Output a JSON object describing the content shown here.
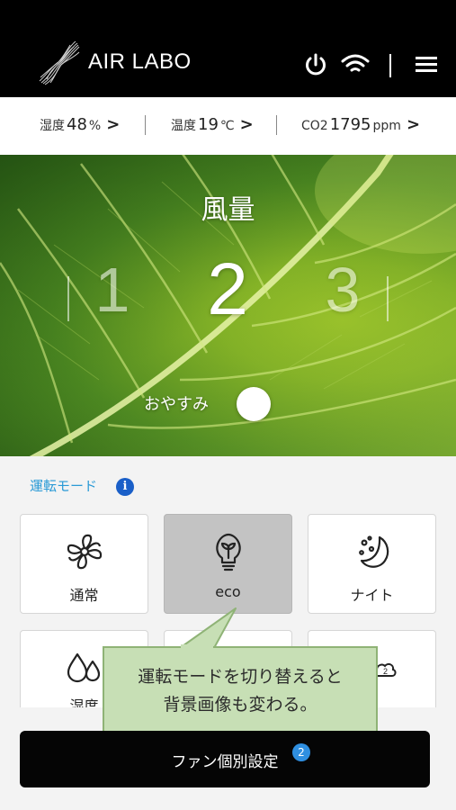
{
  "header": {
    "brand": "AIR LABO",
    "icons": [
      "logo-icon",
      "power-icon",
      "wifi-icon",
      "menu-icon"
    ]
  },
  "status": {
    "humidity": {
      "label": "湿度",
      "value": "48",
      "unit": "%"
    },
    "temperature": {
      "label": "温度",
      "value": "19",
      "unit": "℃"
    },
    "co2": {
      "label": "CO2",
      "value": "1795",
      "unit": "ppm"
    },
    "chevron": ">"
  },
  "hero": {
    "title": "風量",
    "speeds": [
      "1",
      "2",
      "3"
    ],
    "selected_speed": "2",
    "sleep_label": "おやすみ",
    "sleep_on": false
  },
  "mode": {
    "title": "運転モード",
    "info_icon": "i",
    "cards": [
      {
        "label": "通常",
        "icon": "fan-icon",
        "active": false
      },
      {
        "label": "eco",
        "icon": "lightbulb-sprout-icon",
        "active": true
      },
      {
        "label": "ナイト",
        "icon": "moon-stars-icon",
        "active": false
      },
      {
        "label": "湿度",
        "icon": "water-drops-icon",
        "active": false
      },
      {
        "label": "",
        "icon": "",
        "active": false
      },
      {
        "label": "",
        "icon": "cloud-2-icon",
        "active": false
      }
    ]
  },
  "callout": {
    "line1": "運転モードを切り替えると",
    "line2": "背景画像も変わる。"
  },
  "footer": {
    "button_label": "ファン個別設定",
    "badge": "2"
  },
  "colors": {
    "header_bg": "#000000",
    "accent_blue": "#2a9ad6",
    "info_blue": "#1a5fc8",
    "badge_blue": "#2f8fe0",
    "active_card": "#c3c3c3",
    "callout_fill": "#c7dfb5",
    "callout_border": "#8fb376",
    "leaf_green": "#8cb928"
  }
}
